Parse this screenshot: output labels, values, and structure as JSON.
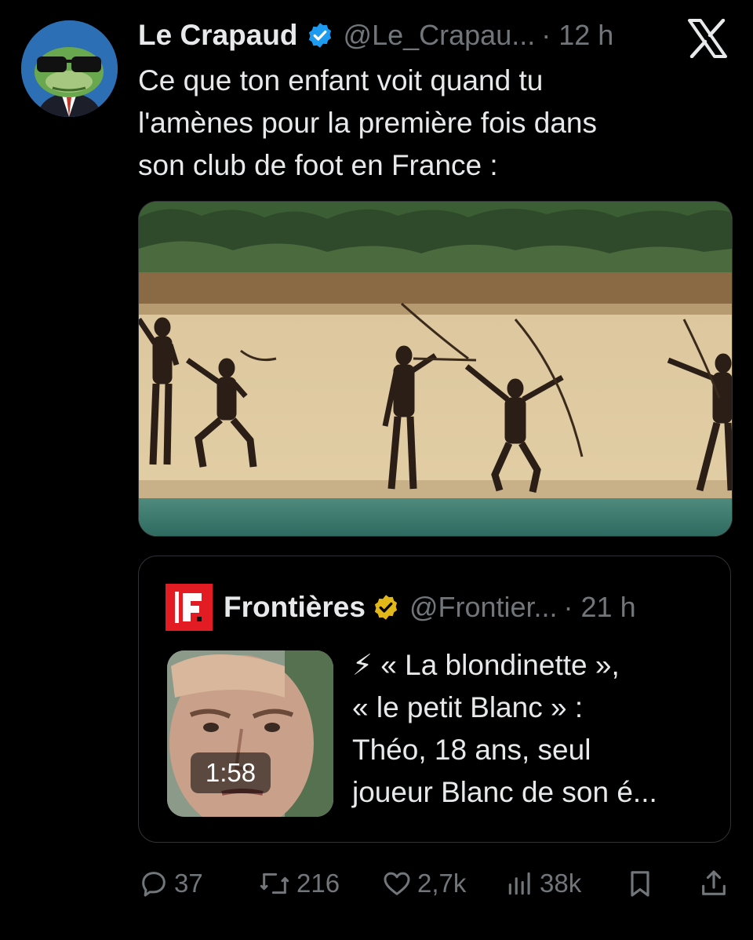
{
  "post": {
    "author_name": "Le Crapaud",
    "author_handle": "@Le_Crapau...",
    "timestamp": "· 12 h",
    "text_lines": [
      "Ce que ton enfant voit quand tu",
      "l'amènes pour la première fois dans",
      "son club de foot en France :"
    ]
  },
  "quote": {
    "author_name": "Frontières",
    "author_handle": "@Frontier...",
    "timestamp": "· 21 h",
    "video_duration": "1:58",
    "text_lines": [
      "⚡ « La blondinette »,",
      "« le petit Blanc » :",
      "Théo, 18 ans, seul",
      "joueur Blanc de son é..."
    ]
  },
  "actions": {
    "replies": "37",
    "reposts": "216",
    "likes": "2,7k",
    "views": "38k"
  },
  "icons": {
    "verified": "verified-badge-icon",
    "org_verified": "gold-verified-badge-icon",
    "platform": "x-logo-icon",
    "reply": "reply-icon",
    "repost": "repost-icon",
    "like": "heart-icon",
    "views": "views-icon",
    "bookmark": "bookmark-icon",
    "share": "share-icon"
  },
  "colors": {
    "background": "#000000",
    "text": "#e7e9ea",
    "secondary_text": "#71767b",
    "verified_blue": "#1d9bf0",
    "verified_gold": "#e2b719",
    "frontieres_red": "#e31b23"
  }
}
